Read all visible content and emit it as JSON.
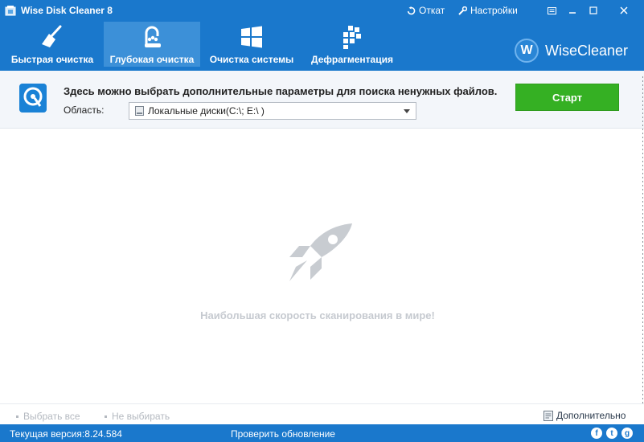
{
  "window": {
    "title": "Wise Disk Cleaner 8",
    "undo_label": "Откат",
    "settings_label": "Настройки"
  },
  "tabs": [
    {
      "label": "Быстрая очистка",
      "icon": "broom-icon",
      "active": false
    },
    {
      "label": "Глубокая очистка",
      "icon": "vacuum-icon",
      "active": true
    },
    {
      "label": "Очистка системы",
      "icon": "windows-icon",
      "active": false
    },
    {
      "label": "Дефрагментация",
      "icon": "defrag-icon",
      "active": false
    }
  ],
  "brand": {
    "name": "WiseCleaner",
    "logo_letter": "W"
  },
  "options": {
    "description": "Здесь можно выбрать дополнительные параметры для поиска ненужных файлов.",
    "area_label": "Область:",
    "area_value": "Локальные диски(C:\\; E:\\ )",
    "start_label": "Старт"
  },
  "main": {
    "slogan": "Наибольшая скорость сканирования в мире!"
  },
  "selection_bar": {
    "select_all": "Выбрать все",
    "select_none": "Не выбирать",
    "advanced": "Дополнительно"
  },
  "status": {
    "version": "Текущая версия:8.24.584",
    "update": "Проверить обновление",
    "social": [
      "f",
      "t",
      "g"
    ]
  },
  "colors": {
    "header_blue": "#1a78cc",
    "active_tab": "#3c90d8",
    "start_green": "#35b023",
    "muted_text": "#c6cad0"
  }
}
